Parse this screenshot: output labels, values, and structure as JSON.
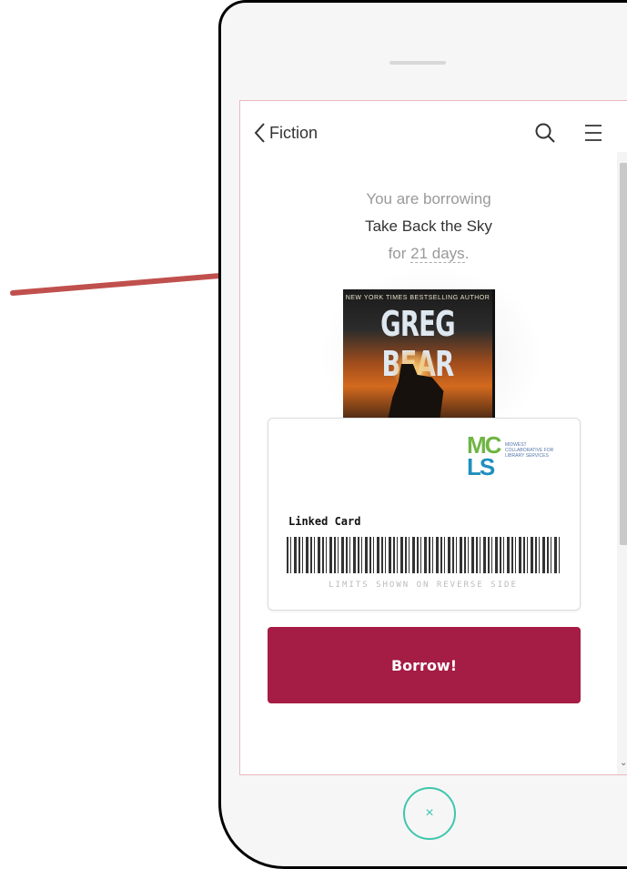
{
  "header": {
    "back_label": "Fiction",
    "back_icon": "chevron-left-icon",
    "search_icon": "search-icon",
    "menu_icon": "menu-icon"
  },
  "borrow_message": {
    "line1": "You are borrowing",
    "title": "Take Back the Sky",
    "for_prefix": "for ",
    "days": "21 days",
    "suffix": "."
  },
  "book_cover": {
    "tagline": "NEW YORK TIMES BESTSELLING AUTHOR",
    "author": "GREG BEAR"
  },
  "library_card": {
    "logo_mc": "MC",
    "logo_ls": "LS",
    "logo_text": "Midwest Collaborative for Library Services",
    "label": "Linked Card",
    "fine_print": "LIMITS SHOWN ON REVERSE SIDE"
  },
  "borrow_button": {
    "label": "Borrow!"
  },
  "close_button": {
    "glyph": "×"
  },
  "colors": {
    "primary": "#a51c45",
    "accent_teal": "#3fc6ad",
    "annotation_arrow": "#c0504d"
  }
}
